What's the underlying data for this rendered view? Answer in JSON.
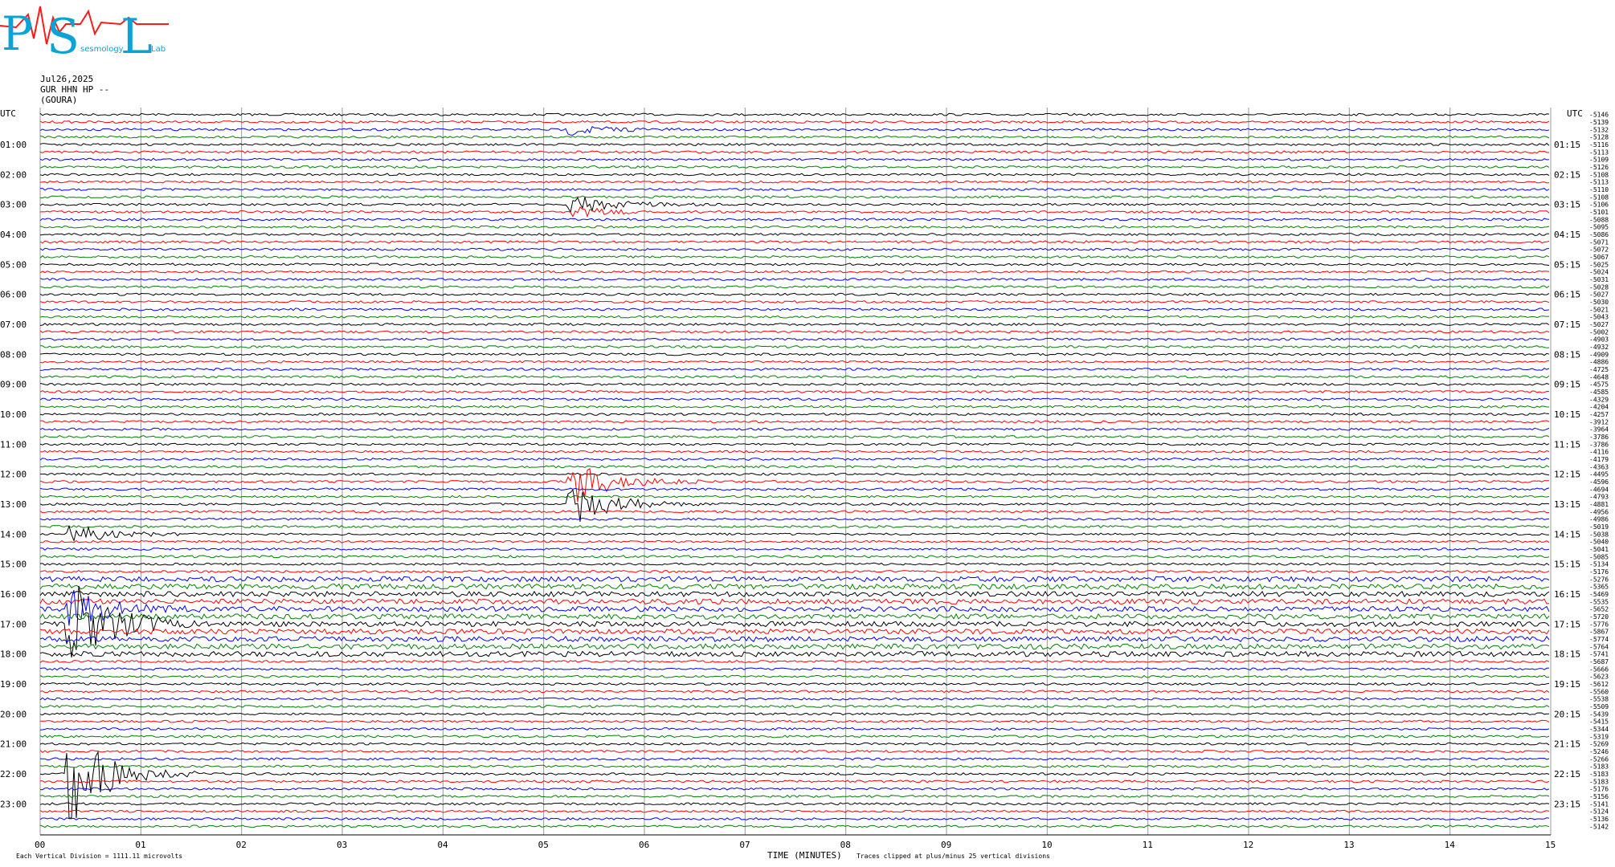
{
  "header": {
    "logo": {
      "letters": [
        "P",
        "S",
        "L"
      ],
      "subtitle": "sesmology",
      "subtitle2": "Lab"
    },
    "date": "Jul26,2025",
    "station": "GUR HHN HP --",
    "location": "(GOURA)"
  },
  "chart_data": {
    "type": "line",
    "title": "Jul26,2025",
    "xlabel": "TIME (MINUTES)",
    "ylabel": "UTC",
    "xlim": [
      0,
      15
    ],
    "x_ticks": [
      "00",
      "01",
      "02",
      "03",
      "04",
      "05",
      "06",
      "07",
      "08",
      "09",
      "10",
      "11",
      "12",
      "13",
      "14",
      "15"
    ],
    "left_axis_label": "UTC",
    "right_axis_label": "UTC",
    "left_hour_labels": [
      "01:00",
      "02:00",
      "03:00",
      "04:00",
      "05:00",
      "06:00",
      "07:00",
      "08:00",
      "09:00",
      "10:00",
      "11:00",
      "12:00",
      "13:00",
      "14:00",
      "15:00",
      "16:00",
      "17:00",
      "18:00",
      "19:00",
      "20:00",
      "21:00",
      "22:00",
      "23:00"
    ],
    "right_hour_labels": [
      "01:15",
      "02:15",
      "03:15",
      "04:15",
      "05:15",
      "06:15",
      "07:15",
      "08:15",
      "09:15",
      "10:15",
      "11:15",
      "12:15",
      "13:15",
      "14:15",
      "15:15",
      "16:15",
      "17:15",
      "18:15",
      "19:15",
      "20:15",
      "21:15",
      "22:15",
      "23:15"
    ],
    "trace_colors": [
      "#000000",
      "#ff0000",
      "#0000ff",
      "#008000"
    ],
    "trace_count": 96,
    "minutes_per_trace": 15,
    "trace_offsets": [
      "-5146",
      "-5139",
      "-5132",
      "-5128",
      "-5116",
      "-5113",
      "-5109",
      "-5126",
      "-5108",
      "-5113",
      "-5110",
      "-5108",
      "-5106",
      "-5101",
      "-5088",
      "-5095",
      "-5086",
      "-5071",
      "-5072",
      "-5067",
      "-5025",
      "-5024",
      "-5031",
      "-5028",
      "-5027",
      "-5030",
      "-5021",
      "-5043",
      "-5027",
      "-5002",
      "-4903",
      "-4932",
      "-4909",
      "-4886",
      "-4725",
      "-4648",
      "-4575",
      "-4585",
      "-4329",
      "-4204",
      "-4257",
      "-3912",
      "-3964",
      "-3786",
      "-3786",
      "-4116",
      "-4179",
      "-4363",
      "-4495",
      "-4596",
      "-4694",
      "-4793",
      "-4881",
      "-4956",
      "-4986",
      "-5019",
      "-5038",
      "-5040",
      "-5041",
      "-5085",
      "-5134",
      "-5176",
      "-5276",
      "-5365",
      "-5469",
      "-5535",
      "-5652",
      "-5720",
      "-5776",
      "-5867",
      "-5774",
      "-5764",
      "-5741",
      "-5687",
      "-5666",
      "-5623",
      "-5612",
      "-5560",
      "-5538",
      "-5509",
      "-5439",
      "-5415",
      "-5344",
      "-5319",
      "-5269",
      "-5246",
      "-5266",
      "-5183",
      "-5183",
      "-5183",
      "-5176",
      "-5156",
      "-5141",
      "-5124",
      "-5136",
      "-5142"
    ],
    "events": [
      {
        "time_utc": "00:35",
        "amplitude": "small"
      },
      {
        "time_utc": "03:05",
        "amplitude": "medium"
      },
      {
        "time_utc": "03:20",
        "amplitude": "small"
      },
      {
        "time_utc": "12:20",
        "amplitude": "large"
      },
      {
        "time_utc": "13:05",
        "amplitude": "large"
      },
      {
        "time_utc": "14:00",
        "amplitude": "medium"
      },
      {
        "time_utc": "16:30",
        "amplitude": "large"
      },
      {
        "time_utc": "17:00",
        "amplitude": "very-large"
      },
      {
        "time_utc": "22:00",
        "amplitude": "very-large"
      }
    ],
    "grid": true
  },
  "footer": {
    "scale_note": "Each Vertical Division = 1111.11 microvolts",
    "clip_note": "Traces clipped at plus/minus 25 vertical divisions",
    "x_title": "TIME (MINUTES)"
  }
}
